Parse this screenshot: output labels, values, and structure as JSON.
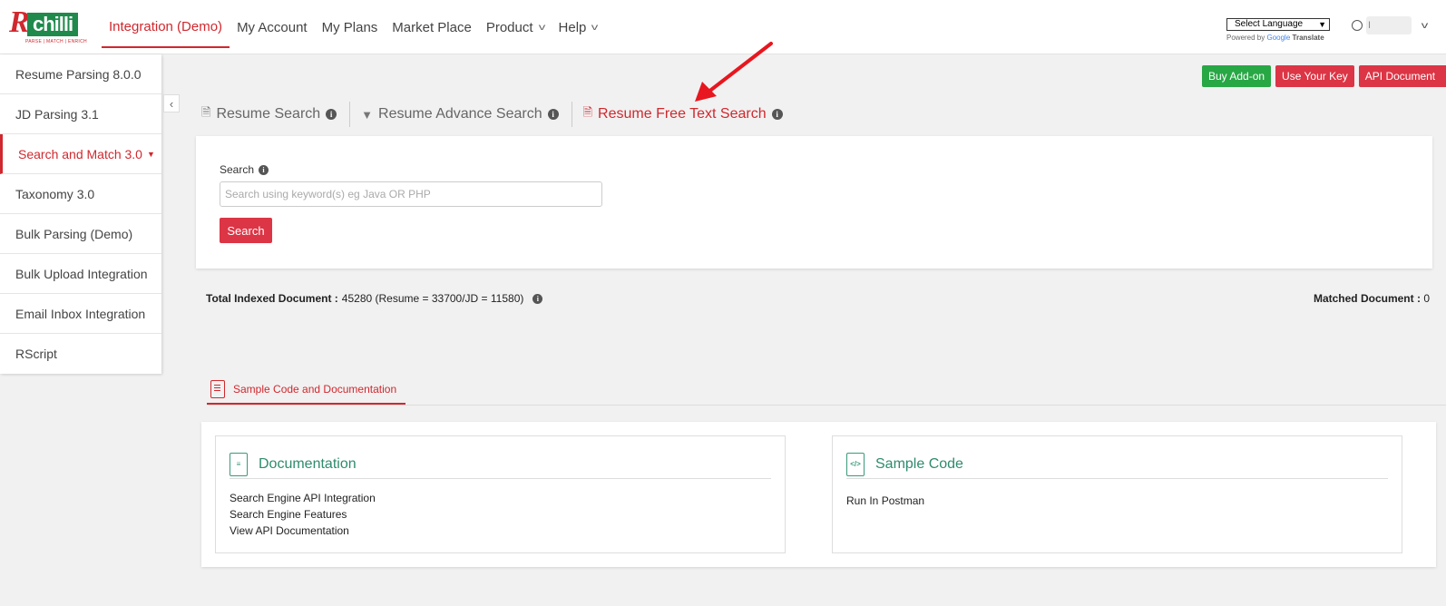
{
  "brand": {
    "logo_letter": "R",
    "logo_text": "chilli",
    "tagline": "PARSE | MATCH | ENRICH"
  },
  "nav": {
    "items": [
      {
        "label": "Integration (Demo)",
        "active": true,
        "dropdown": false
      },
      {
        "label": "My Account",
        "active": false,
        "dropdown": false
      },
      {
        "label": "My Plans",
        "active": false,
        "dropdown": false
      },
      {
        "label": "Market Place",
        "active": false,
        "dropdown": false
      },
      {
        "label": "Product",
        "active": false,
        "dropdown": true
      },
      {
        "label": "Help",
        "active": false,
        "dropdown": true
      }
    ]
  },
  "language": {
    "selected": "Select Language",
    "powered_prefix": "Powered by",
    "google": "Google",
    "translate": "Translate"
  },
  "user": {
    "name_initial": "I"
  },
  "sidebar": {
    "items": [
      {
        "label": "Resume Parsing 8.0.0"
      },
      {
        "label": "JD Parsing 3.1"
      },
      {
        "label": "Search and Match 3.0",
        "active": true
      },
      {
        "label": "Taxonomy 3.0"
      },
      {
        "label": "Bulk Parsing (Demo)"
      },
      {
        "label": "Bulk Upload Integration"
      },
      {
        "label": "Email Inbox Integration"
      },
      {
        "label": "RScript"
      }
    ]
  },
  "actions": {
    "buy_addon": "Buy Add-on",
    "use_key": "Use Your Key",
    "api_doc": "API Document"
  },
  "tabs": [
    {
      "label": "Resume Search"
    },
    {
      "label": "Resume Advance Search"
    },
    {
      "label": "Resume Free Text Search",
      "active": true
    }
  ],
  "search": {
    "label": "Search",
    "placeholder": "Search using keyword(s) eg Java OR PHP",
    "value": "",
    "button": "Search"
  },
  "stats": {
    "total_label": "Total Indexed Document :",
    "total_value": "45280 (Resume = 33700/JD = 11580)",
    "matched_label": "Matched Document :",
    "matched_value": "0"
  },
  "docs_tab": {
    "label": "Sample Code and Documentation"
  },
  "documentation": {
    "title": "Documentation",
    "links": [
      "Search Engine API Integration",
      "Search Engine Features",
      "View API Documentation"
    ]
  },
  "sample_code": {
    "title": "Sample Code",
    "icon_text": "</>",
    "links": [
      "Run In Postman"
    ]
  },
  "colors": {
    "brand_red": "#d0282e",
    "green": "#28a745",
    "teal": "#2e8b6e"
  }
}
